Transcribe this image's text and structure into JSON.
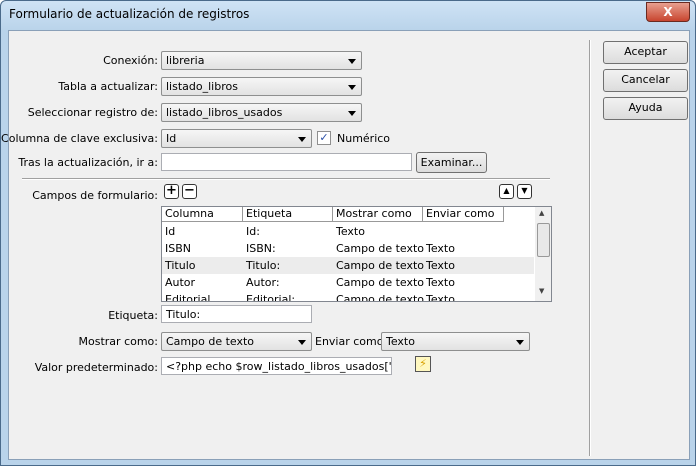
{
  "window": {
    "title": "Formulario de actualización de registros",
    "close": "X"
  },
  "form": {
    "connection": {
      "label": "Conexión:",
      "value": "libreria"
    },
    "table": {
      "label": "Tabla a actualizar:",
      "value": "listado_libros"
    },
    "record": {
      "label": "Seleccionar registro de:",
      "value": "listado_libros_usados"
    },
    "key": {
      "label": "Columna de clave exclusiva:",
      "value": "Id",
      "numeric_label": "Numérico",
      "numeric_checked": true
    },
    "redirect": {
      "label": "Tras la actualización, ir a:",
      "value": "",
      "browse": "Examinar..."
    },
    "fields": {
      "label": "Campos de formulario:",
      "add": "+",
      "remove": "−"
    },
    "grid": {
      "columns": [
        "Columna",
        "Etiqueta",
        "Mostrar como",
        "Enviar como"
      ],
      "rows": [
        [
          "Id",
          "Id:",
          "Texto",
          ""
        ],
        [
          "ISBN",
          "ISBN:",
          "Campo de texto",
          "Texto"
        ],
        [
          "Titulo",
          "Titulo:",
          "Campo de texto",
          "Texto"
        ],
        [
          "Autor",
          "Autor:",
          "Campo de texto",
          "Texto"
        ],
        [
          "Editorial",
          "Editorial:",
          "Campo de texto",
          "Texto"
        ]
      ],
      "selected_row": 2
    },
    "etiqueta": {
      "label": "Etiqueta:",
      "value": "Titulo:"
    },
    "show_as": {
      "label": "Mostrar como:",
      "value": "Campo de texto"
    },
    "send_as": {
      "label": "Enviar como:",
      "value": "Texto"
    },
    "default": {
      "label": "Valor predeterminado:",
      "value": "<?php echo $row_listado_libros_usados['Titulo'];?>"
    }
  },
  "buttons": {
    "ok": "Aceptar",
    "cancel": "Cancelar",
    "help": "Ayuda"
  }
}
